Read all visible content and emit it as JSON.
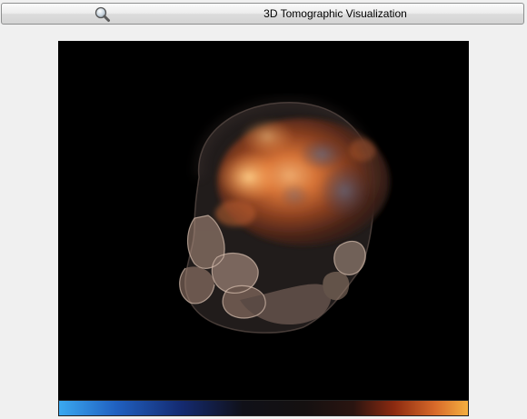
{
  "window": {
    "title": "3D Tomographic Visualization",
    "search_icon": "magnifier-icon"
  },
  "viewport": {
    "background": "#000000",
    "content": "volume-rendered-head"
  },
  "colorbar": {
    "colormap": [
      "#3aa8f0",
      "#1e4fb0",
      "#101020",
      "#151212",
      "#1a1212",
      "#8c2a10",
      "#d86a2a",
      "#f5b040"
    ]
  }
}
